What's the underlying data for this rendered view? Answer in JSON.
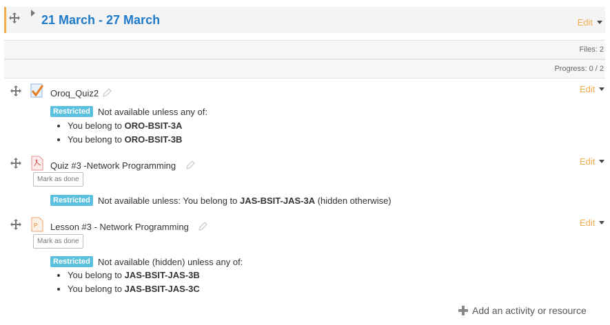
{
  "section": {
    "title": "21 March - 27 March",
    "edit_label": "Edit"
  },
  "summary": {
    "files": "Files: 2",
    "progress": "Progress: 0 / 2"
  },
  "activities": [
    {
      "name": "Oroq_Quiz2",
      "edit_label": "Edit",
      "icon": "quiz-check-icon",
      "badge": "Restricted",
      "restriction": "Not available unless any of:",
      "conditions": [
        {
          "prefix": "You belong to ",
          "group": "ORO-BSIT-3A"
        },
        {
          "prefix": "You belong to ",
          "group": "ORO-BSIT-3B"
        }
      ]
    },
    {
      "name": "Quiz #3 -Network Programming",
      "edit_label": "Edit",
      "icon": "pdf-icon",
      "mark_label": "Mark as done",
      "badge": "Restricted",
      "restriction_prefix": "Not available unless: You belong to ",
      "restriction_group": "JAS-BSIT-JAS-3A",
      "restriction_suffix": " (hidden otherwise)"
    },
    {
      "name": "Lesson #3 - Network Programming",
      "edit_label": "Edit",
      "icon": "powerpoint-icon",
      "mark_label": "Mark as done",
      "badge": "Restricted",
      "restriction": "Not available (hidden) unless any of:",
      "conditions": [
        {
          "prefix": "You belong to ",
          "group": "JAS-BSIT-JAS-3B"
        },
        {
          "prefix": "You belong to ",
          "group": "JAS-BSIT-JAS-3C"
        }
      ]
    }
  ],
  "add_activity_label": "Add an activity or resource",
  "colors": {
    "accent": "#f0ad4e",
    "title": "#1f7ac9",
    "badge": "#5bc0de"
  }
}
